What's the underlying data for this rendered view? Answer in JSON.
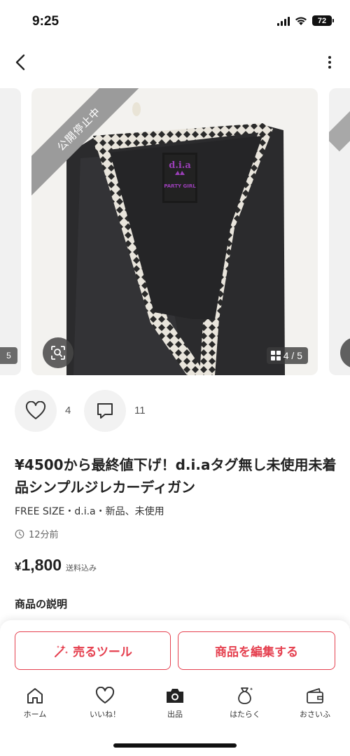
{
  "status_bar": {
    "time": "9:25",
    "battery": "72",
    "icons": [
      "signal-icon",
      "wifi-icon",
      "battery-icon"
    ]
  },
  "header": {
    "back_icon": "chevron-left-icon",
    "more_icon": "more-vertical-icon"
  },
  "carousel": {
    "ribbon": "公開停止中",
    "counter": "4 / 5",
    "side_counter": "5",
    "current_index": 4,
    "total": 5,
    "tag_brand": "d.i.a",
    "tag_line": "PARTY GIRL"
  },
  "reactions": {
    "likes": "4",
    "comments": "11"
  },
  "product": {
    "title": "¥4500から最終値下げ！d.i.aタグ無し未使用未着品シンプルジレカーディガン",
    "meta": "FREE SIZE・d.i.a・新品、未使用",
    "posted": "12分前",
    "price_symbol": "¥",
    "price": "1,800",
    "shipping": "送料込み",
    "description_heading": "商品の説明"
  },
  "actions": {
    "sell_tool": "売るツール",
    "edit": "商品を編集する"
  },
  "tabs": [
    {
      "label": "ホーム",
      "icon": "home-icon"
    },
    {
      "label": "いいね！",
      "icon": "heart-icon"
    },
    {
      "label": "出品",
      "icon": "camera-icon"
    },
    {
      "label": "はたらく",
      "icon": "money-bag-icon"
    },
    {
      "label": "おさいふ",
      "icon": "wallet-icon"
    }
  ],
  "colors": {
    "accent": "#e5404f",
    "text": "#222222",
    "ribbon": "#9b9b9b"
  }
}
